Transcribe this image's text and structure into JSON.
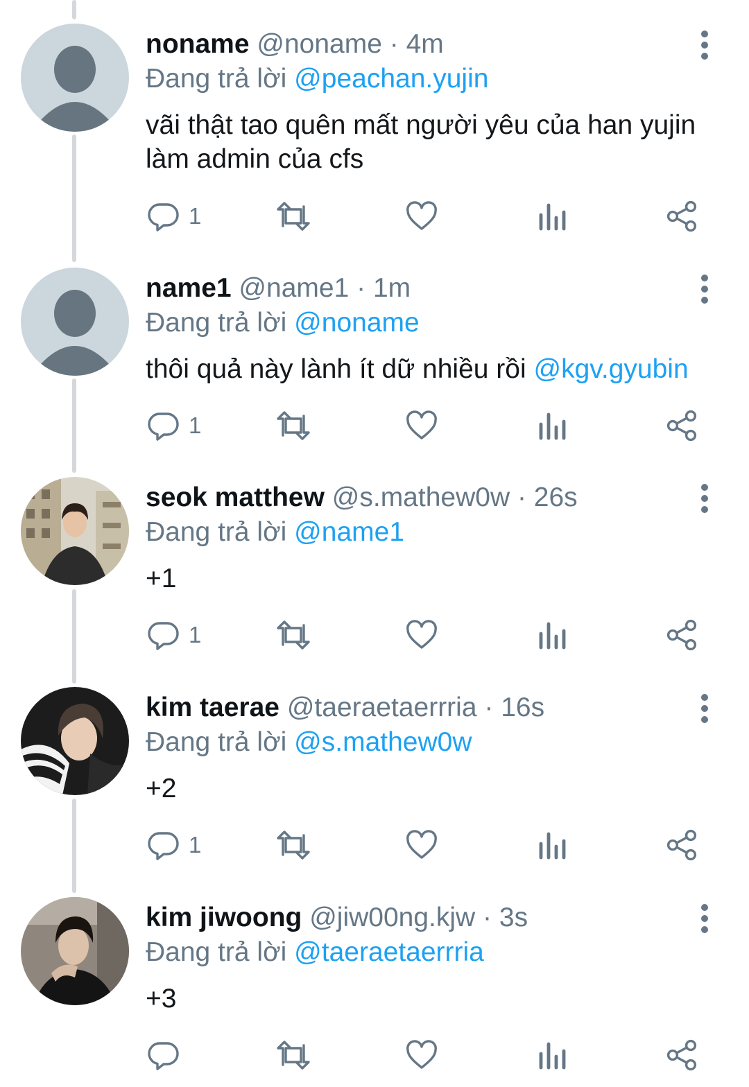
{
  "tweets": [
    {
      "name": "noname",
      "handle": "@noname",
      "dot": "·",
      "time": "4m",
      "replying_label": "Đang trả lời",
      "replying_to": "@peachan.yujin",
      "text": "vãi thật tao quên mất người yêu của han yujin làm admin của cfs",
      "mention": "",
      "reply_count": "1",
      "avatar": "default-avatar"
    },
    {
      "name": "name1",
      "handle": "@name1",
      "dot": "·",
      "time": "1m",
      "replying_label": "Đang trả lời",
      "replying_to": "@noname",
      "text": "thôi quả này lành ít dữ nhiều rồi ",
      "mention": "@kgv.gyubin",
      "reply_count": "1",
      "avatar": "default-avatar"
    },
    {
      "name": "seok matthew",
      "handle": "@s.mathew0w",
      "dot": "·",
      "time": "26s",
      "replying_label": "Đang trả lời",
      "replying_to": "@name1",
      "text": "+1",
      "mention": "",
      "reply_count": "1",
      "avatar": "photo-avatar"
    },
    {
      "name": "kim taerae",
      "handle": "@taeraetaerrria",
      "dot": "·",
      "time": "16s",
      "replying_label": "Đang trả lời",
      "replying_to": "@s.mathew0w",
      "text": "+2",
      "mention": "",
      "reply_count": "1",
      "avatar": "photo-avatar"
    },
    {
      "name": "kim jiwoong",
      "handle": "@jiw00ng.kjw",
      "dot": "·",
      "time": "3s",
      "replying_label": "Đang trả lời",
      "replying_to": "@taeraetaerrria",
      "text": "+3",
      "mention": "",
      "reply_count": "",
      "avatar": "photo-avatar"
    }
  ],
  "icons": {
    "reply": "reply-icon",
    "retweet": "retweet-icon",
    "like": "heart-icon",
    "views": "analytics-icon",
    "share": "share-icon",
    "more": "more-icon"
  },
  "colors": {
    "text": "#0f1419",
    "secondary": "#657786",
    "mention": "#1da1f2",
    "icon": "#657786",
    "thread_line": "#d4d8dc",
    "default_avatar_bg": "#ccd6dd",
    "default_avatar_fg": "#66757f"
  }
}
